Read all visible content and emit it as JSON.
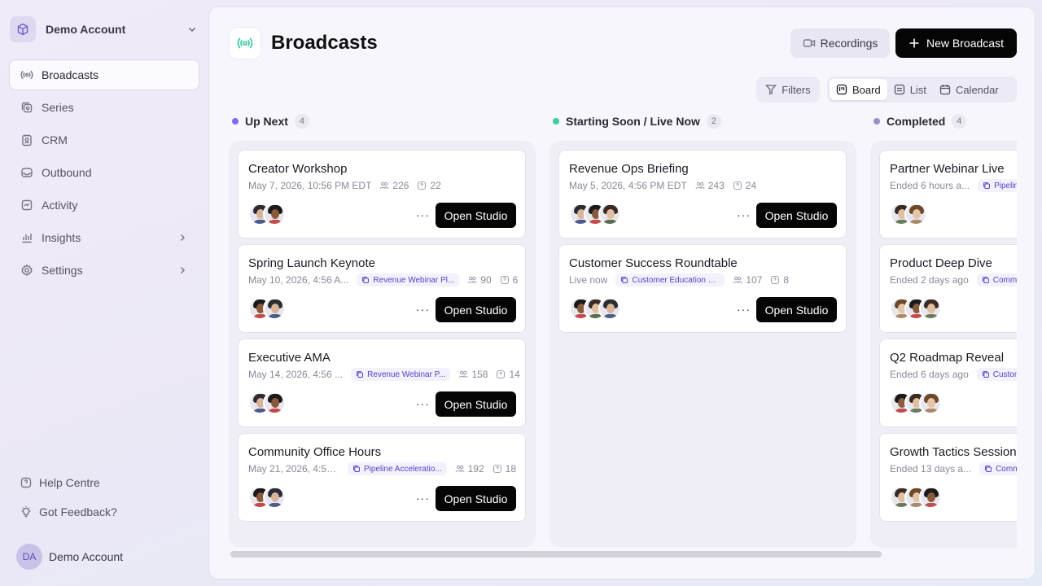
{
  "sidebar": {
    "account_name": "Demo Account",
    "nav": [
      {
        "label": "Broadcasts",
        "icon": "broadcast-icon",
        "active": true
      },
      {
        "label": "Series",
        "icon": "series-icon"
      },
      {
        "label": "CRM",
        "icon": "crm-icon"
      },
      {
        "label": "Outbound",
        "icon": "outbound-icon"
      },
      {
        "label": "Activity",
        "icon": "activity-icon"
      },
      {
        "label": "Insights",
        "icon": "insights-icon",
        "expandable": true
      },
      {
        "label": "Settings",
        "icon": "settings-icon",
        "expandable": true
      }
    ],
    "help_label": "Help Centre",
    "feedback_label": "Got Feedback?",
    "user_initials": "DA",
    "user_name": "Demo Account"
  },
  "header": {
    "title": "Broadcasts",
    "recordings_label": "Recordings",
    "new_broadcast_label": "New Broadcast",
    "filters_label": "Filters",
    "views": [
      "Board",
      "List",
      "Calendar"
    ],
    "active_view": "Board"
  },
  "colors": {
    "accent_upnext": "#7b6cf0",
    "accent_live": "#3fcf9e",
    "accent_completed": "#9d8fc4",
    "broadcast_icon": "#3fc9a5"
  },
  "columns": [
    {
      "title": "Up Next",
      "count": "4",
      "cards": [
        {
          "title": "Creator Workshop",
          "date": "May 7, 2026, 10:56 PM EDT",
          "series": "",
          "attendees": "226",
          "questions": "22",
          "action": "Open Studio"
        },
        {
          "title": "Spring Launch Keynote",
          "date": "May 10, 2026, 4:56 A...",
          "series": "Revenue Webinar Pl...",
          "attendees": "90",
          "questions": "6",
          "action": "Open Studio"
        },
        {
          "title": "Executive AMA",
          "date": "May 14, 2026, 4:56 ...",
          "series": "Revenue Webinar P...",
          "attendees": "158",
          "questions": "14",
          "action": "Open Studio"
        },
        {
          "title": "Community Office Hours",
          "date": "May 21, 2026, 4:56...",
          "series": "Pipeline Acceleratio...",
          "attendees": "192",
          "questions": "18",
          "action": "Open Studio"
        }
      ]
    },
    {
      "title": "Starting Soon / Live Now",
      "count": "2",
      "cards": [
        {
          "title": "Revenue Ops Briefing",
          "date": "May 5, 2026, 4:56 PM EDT",
          "series": "",
          "attendees": "243",
          "questions": "24",
          "action": "Open Studio"
        },
        {
          "title": "Customer Success Roundtable",
          "date": "Live now",
          "series": "Customer Education Li...",
          "attendees": "107",
          "questions": "8",
          "action": "Open Studio"
        }
      ]
    },
    {
      "title": "Completed",
      "count": "4",
      "cards": [
        {
          "title": "Partner Webinar Live",
          "date": "Ended 6 hours a...",
          "series": "Pipeline"
        },
        {
          "title": "Product Deep Dive",
          "date": "Ended 2 days ago",
          "series": "Comm"
        },
        {
          "title": "Q2 Roadmap Reveal",
          "date": "Ended 6 days ago",
          "series": "Custon"
        },
        {
          "title": "Growth Tactics Session",
          "date": "Ended 13 days a...",
          "series": "Comm"
        }
      ]
    }
  ]
}
